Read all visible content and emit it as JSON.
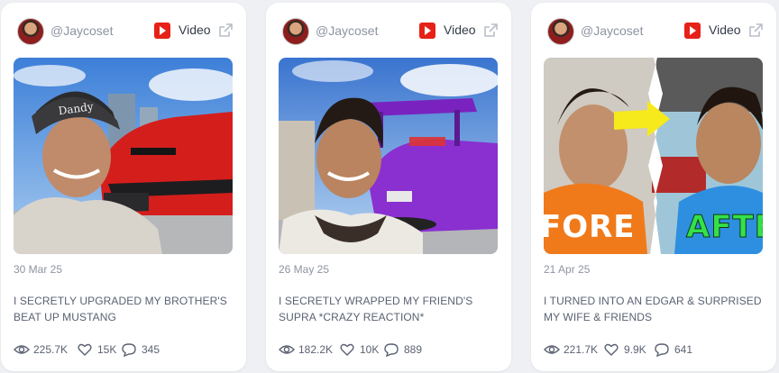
{
  "cards": [
    {
      "author": "@Jaycoset",
      "type_label": "Video",
      "thumbnail_text": "",
      "date": "30 Mar 25",
      "title": "I SECRETLY UPGRADED MY BROTHER'S BEAT UP MUSTANG",
      "views": "225.7K",
      "likes": "15K",
      "comments": "345"
    },
    {
      "author": "@Jaycoset",
      "type_label": "Video",
      "thumbnail_text": "",
      "date": "26 May 25",
      "title": "I SECRETLY WRAPPED MY FRIEND'S SUPRA *CRAZY REACTION*",
      "views": "182.2K",
      "likes": "10K",
      "comments": "889"
    },
    {
      "author": "@Jaycoset",
      "type_label": "Video",
      "thumbnail_text_left": "FORE",
      "thumbnail_text_right": "AFTE",
      "date": "21 Apr 25",
      "title": "I TURNED INTO AN EDGAR & SURPRISED MY WIFE & FRIENDS",
      "views": "221.7K",
      "likes": "9.9K",
      "comments": "641"
    }
  ],
  "colors": {
    "background": "#eef0f3",
    "card": "#ffffff",
    "youtube_red": "#e62117",
    "muted_text": "#8d93a1",
    "body_text": "#5a6272",
    "after_green": "#35e04a"
  },
  "icons": [
    "avatar",
    "youtube-icon",
    "external-link-icon",
    "eye-icon",
    "heart-icon",
    "comment-icon"
  ]
}
